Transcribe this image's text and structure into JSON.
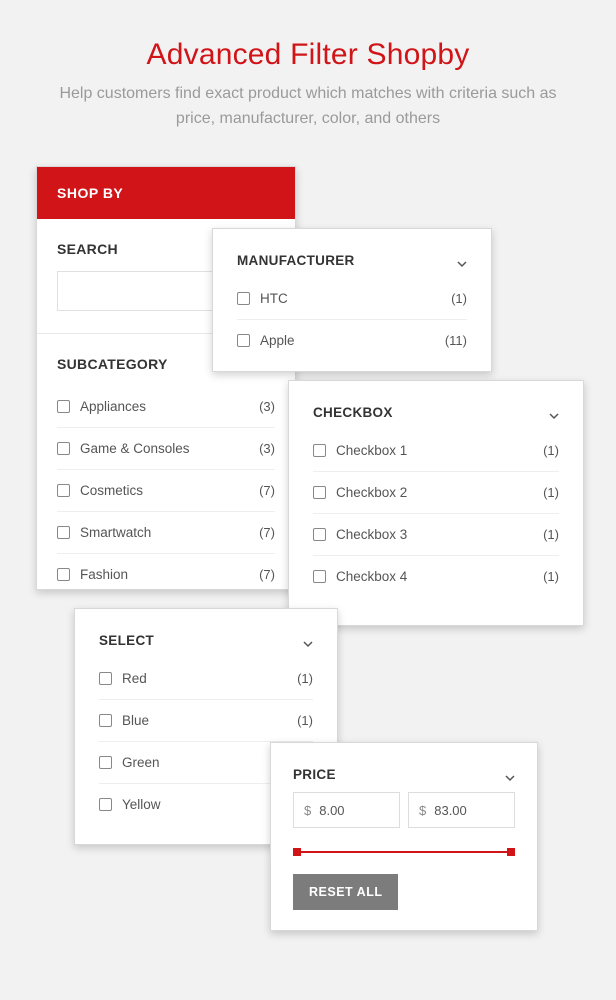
{
  "header": {
    "title": "Advanced Filter Shopby",
    "subtitle": "Help customers find exact product which matches with criteria such as price, manufacturer, color, and others"
  },
  "shopby": {
    "header": "SHOP BY",
    "search_label": "SEARCH",
    "subcategory_label": "SUBCATEGORY",
    "subcategories": [
      {
        "label": "Appliances",
        "count": "3"
      },
      {
        "label": "Game & Consoles",
        "count": "3"
      },
      {
        "label": "Cosmetics",
        "count": "7"
      },
      {
        "label": "Smartwatch",
        "count": "7"
      },
      {
        "label": "Fashion",
        "count": "7"
      }
    ]
  },
  "manufacturer": {
    "title": "MANUFACTURER",
    "items": [
      {
        "label": "HTC",
        "count": "1"
      },
      {
        "label": "Apple",
        "count": "11"
      }
    ]
  },
  "checkbox": {
    "title": "CHECKBOX",
    "items": [
      {
        "label": "Checkbox 1",
        "count": "1"
      },
      {
        "label": "Checkbox 2",
        "count": "1"
      },
      {
        "label": "Checkbox 3",
        "count": "1"
      },
      {
        "label": "Checkbox 4",
        "count": "1"
      }
    ]
  },
  "select": {
    "title": "SELECT",
    "items": [
      {
        "label": "Red",
        "count": "1"
      },
      {
        "label": "Blue",
        "count": "1"
      },
      {
        "label": "Green",
        "count": ""
      },
      {
        "label": "Yellow",
        "count": ""
      }
    ]
  },
  "price": {
    "title": "PRICE",
    "currency": "$",
    "min": "8.00",
    "max": "83.00",
    "reset_label": "RESET ALL"
  }
}
